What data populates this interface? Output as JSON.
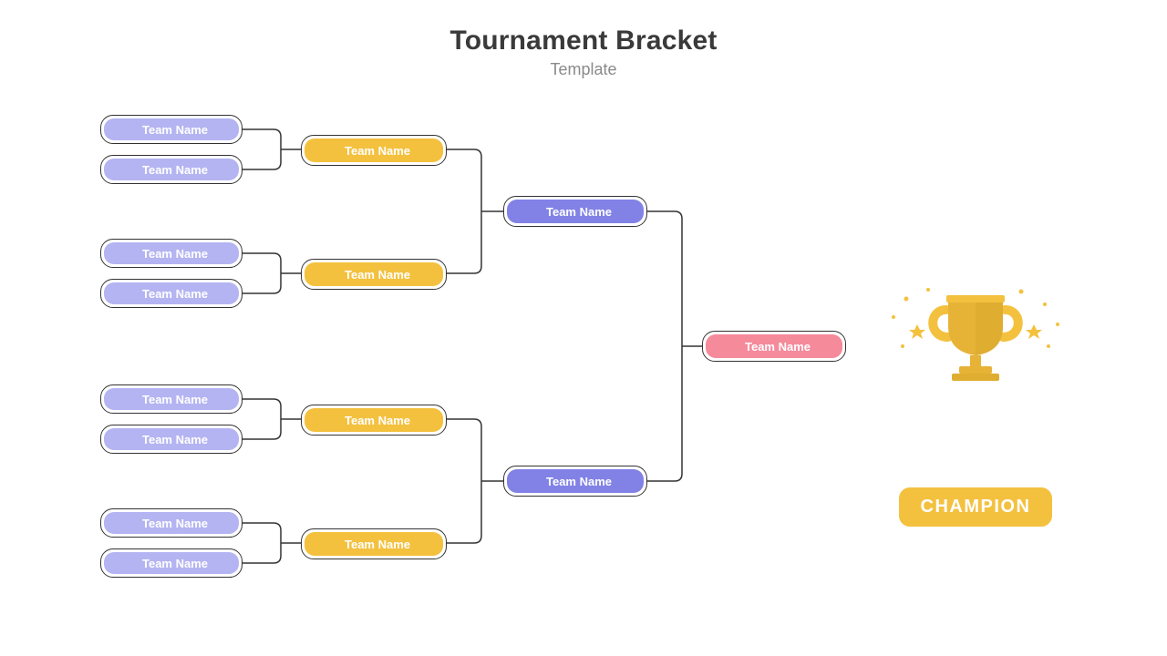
{
  "header": {
    "title": "Tournament Bracket",
    "subtitle": "Template"
  },
  "round1": [
    "Team Name",
    "Team Name",
    "Team Name",
    "Team Name",
    "Team Name",
    "Team Name",
    "Team Name",
    "Team Name"
  ],
  "round2": [
    "Team Name",
    "Team Name",
    "Team Name",
    "Team Name"
  ],
  "round3": [
    "Team Name",
    "Team Name"
  ],
  "final": "Team Name",
  "champion_label": "CHAMPION",
  "colors": {
    "lilac": "#b4b4f2",
    "yellow": "#f4c13f",
    "violet": "#8282e6",
    "pink": "#f58a9b",
    "text_dark": "#3a3a3a",
    "text_muted": "#8a8a8a",
    "stroke": "#333333"
  }
}
